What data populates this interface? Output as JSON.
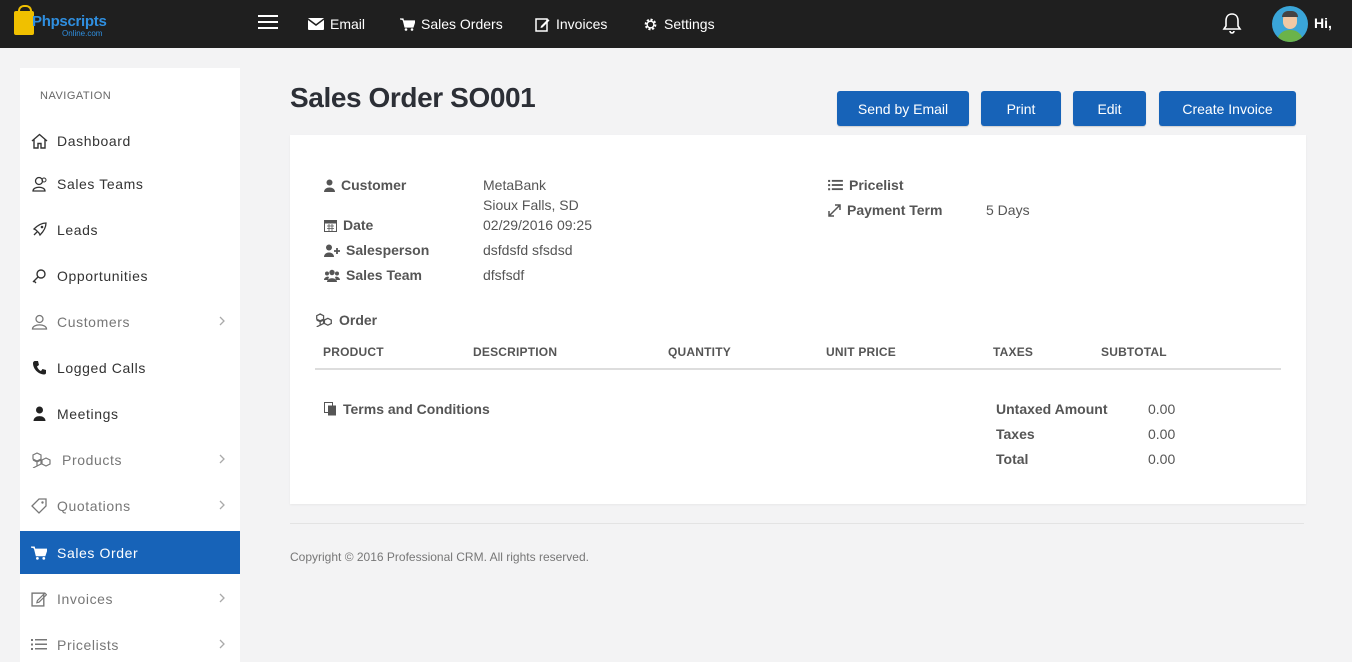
{
  "topbar": {
    "logo_text": "Phpscripts",
    "logo_sub": "Online.com",
    "nav": [
      {
        "label": "Email",
        "icon": "envelope-icon"
      },
      {
        "label": "Sales Orders",
        "icon": "cart-icon"
      },
      {
        "label": "Invoices",
        "icon": "edit-icon"
      },
      {
        "label": "Settings",
        "icon": "gear-icon"
      }
    ],
    "greeting": "Hi,"
  },
  "sidebar": {
    "title": "NAVIGATION",
    "items": [
      {
        "label": "Dashboard",
        "icon": "home-icon"
      },
      {
        "label": "Sales Teams",
        "icon": "team-icon"
      },
      {
        "label": "Leads",
        "icon": "rocket-icon"
      },
      {
        "label": "Opportunities",
        "icon": "key-icon"
      },
      {
        "label": "Customers",
        "icon": "user-icon"
      },
      {
        "label": "Logged Calls",
        "icon": "phone-icon"
      },
      {
        "label": "Meetings",
        "icon": "person-icon"
      },
      {
        "label": "Products",
        "icon": "cubes-icon"
      },
      {
        "label": "Quotations",
        "icon": "tag-icon"
      },
      {
        "label": "Sales Order",
        "icon": "cart-icon"
      },
      {
        "label": "Invoices",
        "icon": "edit-icon"
      },
      {
        "label": "Pricelists",
        "icon": "list-icon"
      }
    ]
  },
  "page": {
    "title": "Sales Order SO001",
    "buttons": {
      "send_email": "Send by Email",
      "print": "Print",
      "edit": "Edit",
      "create_invoice": "Create Invoice"
    }
  },
  "order": {
    "customer_label": "Customer",
    "customer_name": "MetaBank",
    "customer_address": "Sioux Falls, SD",
    "date_label": "Date",
    "date_value": "02/29/2016 09:25",
    "salesperson_label": "Salesperson",
    "salesperson_value": "dsfdsfd sfsdsd",
    "sales_team_label": "Sales Team",
    "sales_team_value": "dfsfsdf",
    "pricelist_label": "Pricelist",
    "payment_term_label": "Payment Term",
    "payment_term_value": "5 Days",
    "order_section": "Order",
    "columns": [
      "PRODUCT",
      "DESCRIPTION",
      "QUANTITY",
      "UNIT PRICE",
      "TAXES",
      "SUBTOTAL"
    ],
    "terms_label": "Terms and Conditions",
    "totals": {
      "untaxed_label": "Untaxed Amount",
      "untaxed_value": "0.00",
      "taxes_label": "Taxes",
      "taxes_value": "0.00",
      "total_label": "Total",
      "total_value": "0.00"
    }
  },
  "footer": {
    "copyright": "Copyright © 2016 Professional CRM. All rights reserved."
  },
  "colors": {
    "accent": "#1763b8",
    "topbar": "#1f1f1f",
    "background": "#f3f3f4"
  }
}
